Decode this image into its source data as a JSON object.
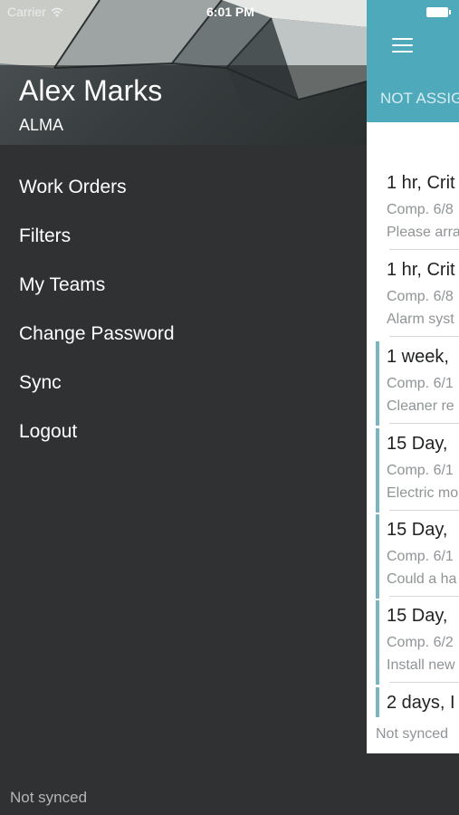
{
  "status_bar": {
    "carrier": "Carrier",
    "time": "6:01 PM"
  },
  "drawer": {
    "user_name": "Alex Marks",
    "organization": "ALMA",
    "menu": [
      {
        "label": "Work Orders"
      },
      {
        "label": "Filters"
      },
      {
        "label": "My Teams"
      },
      {
        "label": "Change Password"
      },
      {
        "label": "Sync"
      },
      {
        "label": "Logout"
      }
    ],
    "footer_status": "Not synced"
  },
  "main": {
    "tab_label": "NOT ASSIG",
    "work_orders": [
      {
        "title": "1 hr, Crit",
        "date": "Comp. 6/8",
        "description": "Please arra",
        "flagged": false
      },
      {
        "title": "1 hr, Crit",
        "date": "Comp. 6/8",
        "description": "Alarm syst",
        "flagged": false
      },
      {
        "title": "1 week,",
        "date": "Comp. 6/1",
        "description": "Cleaner re",
        "flagged": true
      },
      {
        "title": "15 Day,",
        "date": "Comp. 6/1",
        "description": "Electric mo",
        "flagged": true
      },
      {
        "title": "15 Day,",
        "date": "Comp. 6/1",
        "description": "Could a ha",
        "flagged": true
      },
      {
        "title": "15 Day,",
        "date": "Comp. 6/2",
        "description": "Install new",
        "flagged": true
      },
      {
        "title": "2 days, I",
        "date": "",
        "description": "",
        "flagged": true
      }
    ],
    "list_footer": "Not synced"
  },
  "colors": {
    "accent": "#4eaabb",
    "flag": "#79b6c2",
    "drawer_bg": "#2f3132"
  },
  "icons": [
    "wifi-icon",
    "battery-icon",
    "hamburger-menu-icon"
  ]
}
